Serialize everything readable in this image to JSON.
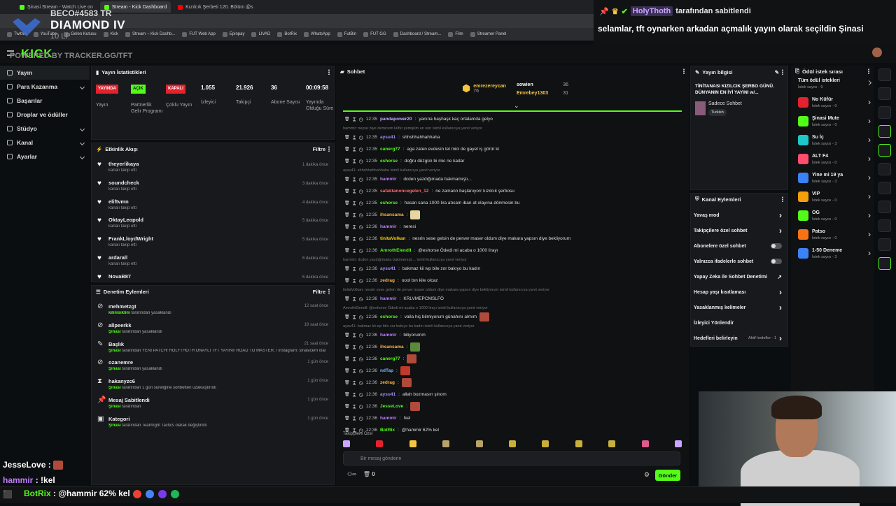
{
  "browser": {
    "tabs": [
      {
        "label": "Şinasi Stream - Watch Live on",
        "active": false,
        "color": "#53fc18"
      },
      {
        "label": "Stream - Kick Dashboard",
        "active": true,
        "color": "#53fc18"
      },
      {
        "label": "Kızılcık Şerbeti 120. Bölüm @s",
        "active": false,
        "color": "#ff0000"
      }
    ],
    "bookmarks": [
      "Twitter",
      "YouTube",
      "Gelen Kutusu",
      "Kick",
      "Stream – Kick Dashb...",
      "FUT Web App",
      "Epinpay",
      "LIVAD",
      "BotRix",
      "WhatsApp",
      "FutBin",
      "FUT GG",
      "Dashboard / Stream...",
      "Film",
      "Streamer Panel"
    ]
  },
  "rank_overlay": {
    "user": "BECO#4583 TR",
    "rank": "DIAMOND IV",
    "lp": "10 LP"
  },
  "powered_by": "POWERED BY TRACKER.GG/TFT",
  "pinned": {
    "name": "HolyThoth",
    "suffix": "tarafından sabitlendi",
    "message": "selamlar, tft oynarken arkadan açmalık yayın olarak seçildin Şinasi"
  },
  "header": {
    "logo": "KICK"
  },
  "sidebar": {
    "items": [
      {
        "label": "Yayın",
        "active": true,
        "chev": false
      },
      {
        "label": "Para Kazanma",
        "active": false,
        "chev": true
      },
      {
        "label": "Başarılar",
        "active": false,
        "chev": false
      },
      {
        "label": "Droplar ve ödüller",
        "active": false,
        "chev": false
      },
      {
        "label": "Stüdyo",
        "active": false,
        "chev": true
      },
      {
        "label": "Kanal",
        "active": false,
        "chev": true
      },
      {
        "label": "Ayarlar",
        "active": false,
        "chev": true
      }
    ]
  },
  "stats": {
    "title": "Yayın İstatistikleri",
    "items": [
      {
        "value": "YAYINDA",
        "label": "Yayın",
        "style": "red"
      },
      {
        "value": "AÇIK",
        "label": "Partnerlik Gelir Programı",
        "style": "green"
      },
      {
        "value": "KAPALI",
        "label": "Çoklu Yayın",
        "style": "red"
      },
      {
        "value": "1.055",
        "label": "İzleyici",
        "style": "num"
      },
      {
        "value": "21.926",
        "label": "Takipçi",
        "style": "num"
      },
      {
        "value": "36",
        "label": "Abone Sayısı",
        "style": "num"
      },
      {
        "value": "00:09:58",
        "label": "Yayında Olduğu Süre",
        "style": "num"
      }
    ]
  },
  "activity": {
    "title": "Etkinlik Akışı",
    "filter": "Filtre",
    "items": [
      {
        "name": "theyerlikaya",
        "sub": "kanalı takip etti",
        "time": "1 dakika önce"
      },
      {
        "name": "soundcheck",
        "sub": "kanalı takip etti",
        "time": "3 dakika önce"
      },
      {
        "name": "eliftvmn",
        "sub": "kanalı takip etti",
        "time": "4 dakika önce"
      },
      {
        "name": "OktayLeopold",
        "sub": "kanalı takip etti",
        "time": "5 dakika önce"
      },
      {
        "name": "FrankLloydWright",
        "sub": "kanalı takip etti",
        "time": "5 dakika önce"
      },
      {
        "name": "ardarall",
        "sub": "kanalı takip etti",
        "time": "6 dakika önce"
      },
      {
        "name": "NovaB87",
        "sub": "",
        "time": "6 dakika önce"
      }
    ]
  },
  "moderation": {
    "title": "Denetim Eylemleri",
    "filter": "Filtre",
    "items": [
      {
        "name": "mehmetzgt",
        "actor": "kilimsiklim",
        "rest": "tarafından yasaklandı",
        "time": "12 saat önce",
        "icon": "ban"
      },
      {
        "name": "allpeerkk",
        "actor": "Şinasi",
        "rest": "tarafından yasaklandı",
        "time": "18 saat önce",
        "icon": "ban"
      },
      {
        "name": "Başlık",
        "actor": "Şinasi",
        "rest": "tarafından YENİ PATCH! HOLYTHOTH ONAYLI TFT YAYINI! ROAD TO MASTER. / instagram: sinasicem olarak değiştirildi",
        "time": "21 saat önce",
        "icon": "edit"
      },
      {
        "name": "ozanemre",
        "actor": "Şinasi",
        "rest": "tarafından yasaklandı",
        "time": "1 gün önce",
        "icon": "ban"
      },
      {
        "name": "hakanyzc6",
        "actor": "Şinasi",
        "rest": "tarafından 1 gün süreliğine sohbetten uzaklaştırıldı",
        "time": "1 gün önce",
        "icon": "timeout"
      },
      {
        "name": "Mesaj Sabitlendi",
        "actor": "Şinasi",
        "rest": "tarafından",
        "time": "1 gün önce",
        "icon": "pin"
      },
      {
        "name": "Kategori",
        "actor": "Şinasi",
        "rest": "tarafından Teamfight Tactics olarak değiştirildi",
        "time": "1 gün önce",
        "icon": "category"
      }
    ]
  },
  "chat": {
    "title": "Sohbet",
    "top_gifters": [
      {
        "name": "emrezereycan",
        "count": "76"
      },
      {
        "name": "sowien",
        "count": "36"
      },
      {
        "name": "Emrebey1303",
        "count": "31"
      }
    ],
    "rows": [
      {
        "type": "msg",
        "time": "12:35",
        "user": "pandapower20",
        "color": "#c9a7ff",
        "text": "yanına haşhaşk kaç ortalamda gelyo"
      },
      {
        "type": "reply",
        "text": "hammir: neyse biye demicem küfür yemişlim en son isimli kullanıcıya yanıt veriyor"
      },
      {
        "type": "msg",
        "time": "12:35",
        "user": "aysu41",
        "color": "#a78bfa",
        "text": "shhshhahhahhaha"
      },
      {
        "type": "msg",
        "time": "12:35",
        "user": "canerg77",
        "color": "#53fc18",
        "text": "aga zaten evdesin tel mici de gayet iş görür ki"
      },
      {
        "type": "msg",
        "time": "12:35",
        "user": "eshorse",
        "color": "#53fc18",
        "text": "doğru düzgün bi mic ne kadar"
      },
      {
        "type": "reply",
        "text": "aysu41: shhshhahhahhaha isimli kullanıcıya yanıt veriyor"
      },
      {
        "type": "msg",
        "time": "12:35",
        "user": "hammir",
        "color": "#c07cff",
        "text": "dcden yazdığımada bakmamıştı..."
      },
      {
        "type": "msg",
        "time": "12:35",
        "user": "safaktanoncegelen_12",
        "color": "#ff6b6b",
        "text": "ne zamann başlanıyorr kızılcık şerbosu"
      },
      {
        "type": "msg",
        "time": "12:35",
        "user": "eshorse",
        "color": "#53fc18",
        "text": "hasan sana 1000 lira atıcam iban at olayına dönmesin bu"
      },
      {
        "type": "msg",
        "time": "12:35",
        "user": "ihsansama",
        "color": "#ffb347",
        "text": "",
        "emote": "#e8d6a0"
      },
      {
        "type": "msg",
        "time": "12:36",
        "user": "hammir",
        "color": "#c07cff",
        "text": "neresi"
      },
      {
        "type": "msg",
        "time": "12:36",
        "user": "tinitaVolkan",
        "color": "#ffd000",
        "text": "nesrin sese gelsin de perver maser oldum diye makara yapsın diye bekliyorum"
      },
      {
        "type": "msg",
        "time": "12:36",
        "user": "AmrothElendil",
        "color": "#53fc18",
        "text": "@eshorse Ödedi mi acaba o 1000 lirayı"
      },
      {
        "type": "reply",
        "text": "hammir: dcden yazdığımada bakmamıştı... isimli kullanıcıya yanıt veriyor"
      },
      {
        "type": "msg",
        "time": "12:36",
        "user": "aysu41",
        "color": "#a78bfa",
        "text": "bakmaz kii wp bile zor bakıyo bu kadın"
      },
      {
        "type": "msg",
        "time": "12:36",
        "user": "zedrag",
        "color": "#ffb347",
        "text": "oool bın kile olcaz"
      },
      {
        "type": "reply",
        "text": "tinitaVolkan: nesrin sese gelsin de perver maser oldum diye makara yapsın diye bekliyorum isimli kullanıcıya yanıt veriyor"
      },
      {
        "type": "msg",
        "time": "12:36",
        "user": "hammir",
        "color": "#c07cff",
        "text": "KRLVMEPCMSLFÖ"
      },
      {
        "type": "reply",
        "text": "AmrothElendil: @eshorse Ödedi mi acaba o 1000 lirayı isimli kullanıcıya yanıt veriyor"
      },
      {
        "type": "msg",
        "time": "12:36",
        "user": "eshorse",
        "color": "#53fc18",
        "text": "valla hiç bilmiyorum günahını almım",
        "emote": "#b04a3a"
      },
      {
        "type": "reply",
        "text": "aysu41: bakmaz kii wp bile zor bakıyo bu kadın isimli kullanıcıya yanıt veriyor"
      },
      {
        "type": "msg",
        "time": "12:36",
        "user": "hammir",
        "color": "#c07cff",
        "text": "biliyorumm"
      },
      {
        "type": "msg",
        "time": "12:36",
        "user": "ihsansama",
        "color": "#ffb347",
        "text": "",
        "emote": "#5b8a3a"
      },
      {
        "type": "msg",
        "time": "12:36",
        "user": "canerg77",
        "color": "#53fc18",
        "text": "",
        "emote": "#b04a3a"
      },
      {
        "type": "msg",
        "time": "12:36",
        "user": "ndTap",
        "color": "#7ab8ff",
        "text": "",
        "emote": "#c0392b"
      },
      {
        "type": "msg",
        "time": "12:36",
        "user": "zedrag",
        "color": "#ffb347",
        "text": "",
        "emote": "#b04a3a"
      },
      {
        "type": "msg",
        "time": "12:36",
        "user": "aysu41",
        "color": "#a78bfa",
        "text": "allah bozmasın şinom"
      },
      {
        "type": "msg",
        "time": "12:36",
        "user": "JesseLove",
        "color": "#53fc18",
        "text": "",
        "emote": "#b04a3a"
      },
      {
        "type": "msg",
        "time": "12:36",
        "user": "hammir",
        "color": "#c07cff",
        "text": "!kel"
      },
      {
        "type": "msg",
        "time": "12:36",
        "user": "BotRix",
        "color": "#53fc18",
        "text": "@hammir 62% kel"
      }
    ],
    "followers_only": "Takipçilere Özel",
    "placeholder": "Bir mesaj gönderin",
    "send": "Gönder",
    "count": "0"
  },
  "stream_info": {
    "title": "Yayın bilgisi",
    "stream_title": "TİNİTANASI KIZILCIK ŞERBO GÜNÜ. DÜNYANIN EN İYİ YAYINI w/...",
    "category": "Sadece Sohbet",
    "tag": "Turkish"
  },
  "channel_actions": {
    "title": "Kanal Eylemleri",
    "items": [
      {
        "label": "Yavaş mod",
        "ctrl": "arrow"
      },
      {
        "label": "Takipçilere özel sohbet",
        "ctrl": "arrow"
      },
      {
        "label": "Abonelere özel sohbet",
        "ctrl": "toggle"
      },
      {
        "label": "Yalnızca ifadelerle sohbet",
        "ctrl": "toggle"
      },
      {
        "label": "Yapay Zeka ile Sohbet Denetimi",
        "ctrl": "ext"
      },
      {
        "label": "Hesap yaşı kısıtlaması",
        "ctrl": "arrow"
      },
      {
        "label": "Yasaklanmış kelimeler",
        "ctrl": "arrow"
      },
      {
        "label": "İzleyici Yönlendir",
        "ctrl": "none"
      },
      {
        "label": "Hedefleri belirleyin",
        "ctrl": "arrow",
        "extra": "Aktif hedefler - 1"
      }
    ]
  },
  "rewards": {
    "title": "Ödül istek sırası",
    "all": "Tüm ödül istekleri",
    "all_sub": "İstek sayısı - 9",
    "items": [
      {
        "name": "No Küfür",
        "sub": "İstek sayısı - 0",
        "color": "#e3222e"
      },
      {
        "name": "Şinasi Mute",
        "sub": "İstek sayısı - 0",
        "color": "#53fc18"
      },
      {
        "name": "Su İç",
        "sub": "İstek sayısı - 3",
        "color": "#1ec8c8"
      },
      {
        "name": "ALT F4",
        "sub": "İstek sayısı - 0",
        "color": "#ff4d6d"
      },
      {
        "name": "Yine mi 19 ya",
        "sub": "İstek sayısı - 3",
        "color": "#3b82f6"
      },
      {
        "name": "VIP",
        "sub": "İstek sayısı - 0",
        "color": "#f59e0b"
      },
      {
        "name": "OG",
        "sub": "İstek sayısı - 0",
        "color": "#53fc18"
      },
      {
        "name": "Patso",
        "sub": "İstek sayısı - 0",
        "color": "#f97316"
      },
      {
        "name": "1-50 Deneme",
        "sub": "İstek sayısı - 3",
        "color": "#3b82f6"
      }
    ]
  },
  "overlay_chat": [
    {
      "user": "JesseLove",
      "text": ""
    },
    {
      "user": "hammir",
      "text": "!kel"
    }
  ],
  "botrix_bar": {
    "user": "BotRix",
    "text": "@hammir 62% kel"
  }
}
